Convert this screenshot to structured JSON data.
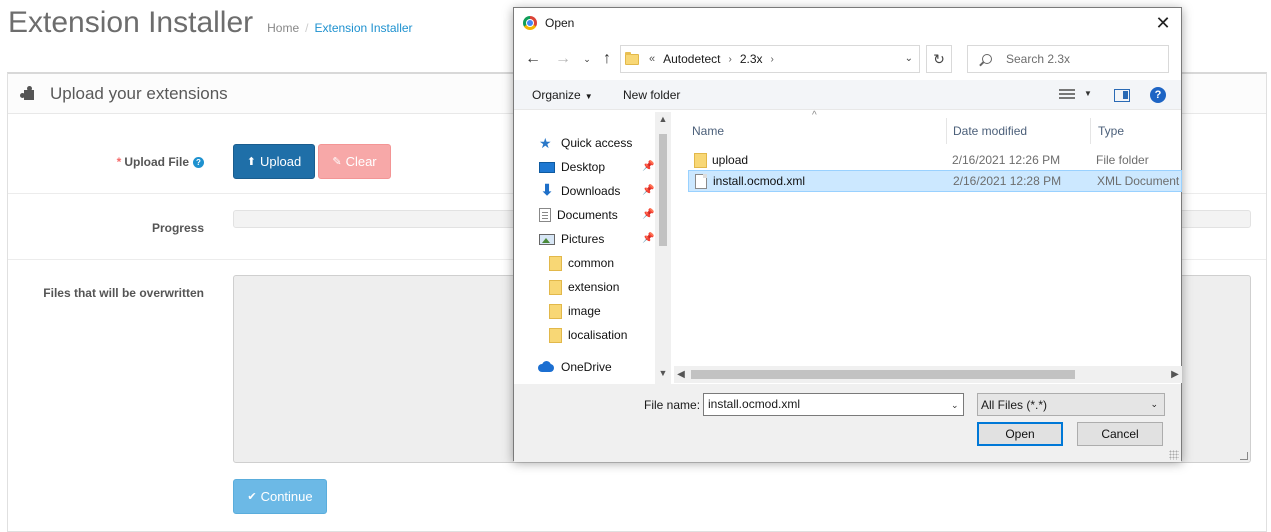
{
  "page": {
    "title": "Extension Installer",
    "breadcrumb": [
      "Home",
      "Extension Installer"
    ],
    "panel_heading": "Upload your extensions",
    "upload_label": "Upload File",
    "upload_button": "Upload",
    "clear_button": "Clear",
    "progress_label": "Progress",
    "progress_value": 0,
    "overwrite_label": "Files that will be overwritten",
    "continue_button": "Continue"
  },
  "dialog": {
    "title": "Open",
    "address": {
      "overflow": "«",
      "segments": [
        "Autodetect",
        "2.3x"
      ]
    },
    "search_placeholder": "Search 2.3x",
    "toolbar": {
      "organize": "Organize",
      "new_folder": "New folder"
    },
    "nav_items": [
      {
        "label": "Quick access",
        "icon": "star-icon"
      },
      {
        "label": "Desktop",
        "icon": "desktop-icon",
        "pinned": true
      },
      {
        "label": "Downloads",
        "icon": "downloads-icon",
        "pinned": true
      },
      {
        "label": "Documents",
        "icon": "documents-icon",
        "pinned": true
      },
      {
        "label": "Pictures",
        "icon": "pictures-icon",
        "pinned": true
      },
      {
        "label": "common",
        "icon": "folder-icon"
      },
      {
        "label": "extension",
        "icon": "folder-icon"
      },
      {
        "label": "image",
        "icon": "folder-icon"
      },
      {
        "label": "localisation",
        "icon": "folder-icon"
      },
      {
        "label": "OneDrive",
        "icon": "onedrive-icon"
      }
    ],
    "columns": [
      "Name",
      "Date modified",
      "Type"
    ],
    "files": [
      {
        "name": "upload",
        "date": "2/16/2021 12:26 PM",
        "type": "File folder",
        "icon": "folder-icon",
        "selected": false
      },
      {
        "name": "install.ocmod.xml",
        "date": "2/16/2021 12:28 PM",
        "type": "XML Document",
        "icon": "xml-file-icon",
        "selected": true
      }
    ],
    "file_name_label": "File name:",
    "file_name_value": "install.ocmod.xml",
    "filter_value": "All Files (*.*)",
    "open_button": "Open",
    "cancel_button": "Cancel"
  },
  "colors": {
    "primary": "#1f6fa8",
    "danger_light": "#f7a8a8",
    "continue_light": "#6cb9e6",
    "selection": "#cce8ff",
    "link": "#1e91cf"
  }
}
